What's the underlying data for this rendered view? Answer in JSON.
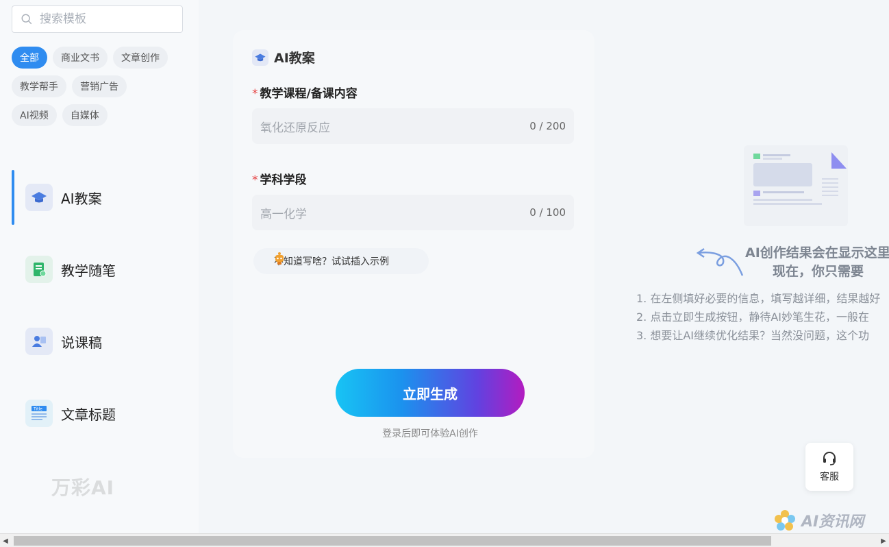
{
  "search": {
    "placeholder": "搜索模板"
  },
  "categories": [
    "全部",
    "商业文书",
    "文章创作",
    "教学帮手",
    "营销广告",
    "AI视频",
    "自媒体"
  ],
  "nav": [
    {
      "label": "AI教案",
      "icon": "mortarboard-icon"
    },
    {
      "label": "教学随笔",
      "icon": "notebook-icon"
    },
    {
      "label": "说课稿",
      "icon": "teacher-icon"
    },
    {
      "label": "文章标题",
      "icon": "title-icon"
    }
  ],
  "logo": {
    "text": "万彩AI"
  },
  "form": {
    "title": "AI教案",
    "field1": {
      "label": "教学课程/备课内容",
      "value": "氧化还原反应",
      "count": "0 / 200"
    },
    "field2": {
      "label": "学科学段",
      "value": "高一化学",
      "count": "0 / 100"
    },
    "required_mark": "*",
    "hint": "不知道写啥？试试插入示例",
    "generate": "立即生成",
    "login_note": "登录后即可体验AI创作"
  },
  "result": {
    "title": "AI创作结果会在显示这里",
    "subtitle": "现在，你只需要",
    "steps": [
      "1. 在左侧填好必要的信息，填写越详细，结果越好",
      "2. 点击立即生成按钮，静待AI妙笔生花，一般在",
      "3. 想要让AI继续优化结果？当然没问题，这个功"
    ]
  },
  "support": {
    "label": "客服"
  },
  "watermark": {
    "text": "AI资讯网"
  },
  "colors": {
    "accent": "#2f8cf0",
    "required": "#e53e3e"
  }
}
